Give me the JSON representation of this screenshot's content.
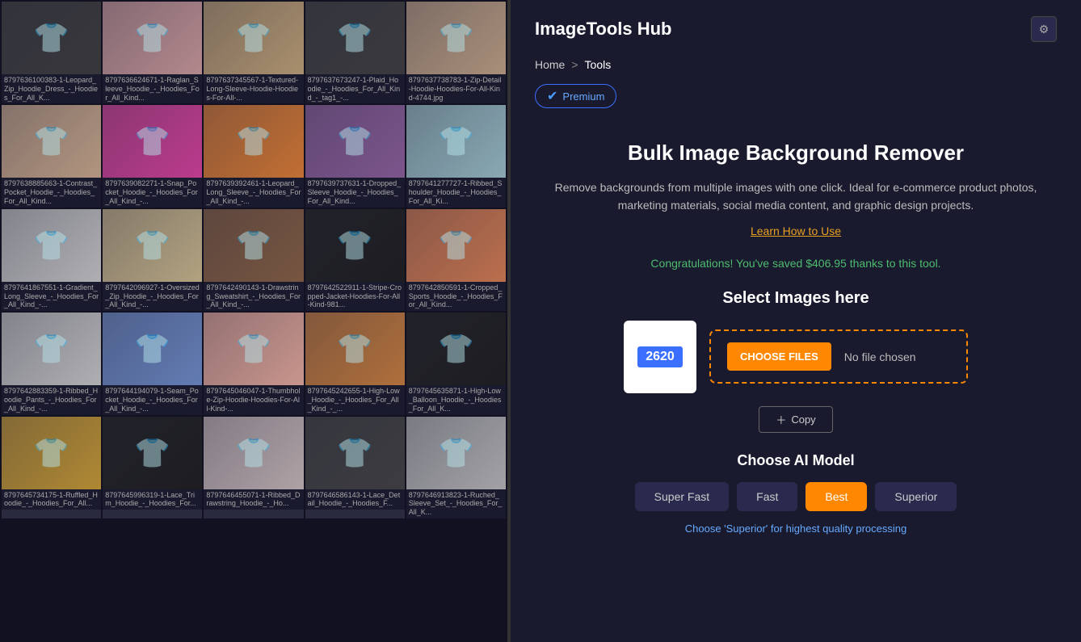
{
  "app": {
    "title": "ImageTools Hub"
  },
  "breadcrumb": {
    "home": "Home",
    "separator": ">",
    "current": "Tools"
  },
  "premium": {
    "label": "Premium"
  },
  "tool": {
    "title": "Bulk Image Background Remover",
    "description": "Remove backgrounds from multiple images with one click. Ideal for e-commerce product photos, marketing materials, social media content, and graphic design projects.",
    "learn_link": "Learn How to Use",
    "savings_msg": "Congratulations! You've saved $406.95 thanks to this tool.",
    "select_title": "Select Images here",
    "count": "2620",
    "choose_files_label": "CHOOSE FILES",
    "no_file_label": "No file chosen",
    "copy_label": "Copy",
    "model_title": "Choose AI Model",
    "model_hint": "Choose 'Superior' for highest quality processing"
  },
  "models": [
    {
      "id": "super-fast",
      "label": "Super Fast",
      "active": false
    },
    {
      "id": "fast",
      "label": "Fast",
      "active": false
    },
    {
      "id": "best",
      "label": "Best",
      "active": true
    },
    {
      "id": "superior",
      "label": "Superior",
      "active": false
    }
  ],
  "images": [
    {
      "id": "img-1",
      "label": "8797636100383-1-Leopard_Zip_Hoodie_Dress_-_Hoodies_For_All_K..."
    },
    {
      "id": "img-2",
      "label": "8797636624671-1-Raglan_Sleeve_Hoodie_-_Hoodies_For_All_Kind..."
    },
    {
      "id": "img-3",
      "label": "8797637345567-1-Textured-Long-Sleeve-Hoodie-Hoodies-For-All-..."
    },
    {
      "id": "img-4",
      "label": "8797637673247-1-Plaid_Hoodie_-_Hoodies_For_All_Kind_-_tag1_-..."
    },
    {
      "id": "img-5",
      "label": "8797637738783-1-Zip-Detail-Hoodie-Hoodies-For-All-Kind-4744.jpg"
    },
    {
      "id": "img-6",
      "label": "8797638885663-1-Contrast_Pocket_Hoodie_-_Hoodies_For_All_Kind..."
    },
    {
      "id": "img-7",
      "label": "8797639082271-1-Snap_Pocket_Hoodie_-_Hoodies_For_All_Kind_-..."
    },
    {
      "id": "img-8",
      "label": "8797639392461-1-Leopard_Long_Sleeve_-_Hoodies_For_All_Kind_-..."
    },
    {
      "id": "img-9",
      "label": "8797639737631-1-Dropped_Sleeve_Hoodie_-_Hoodies_For_All_Kind..."
    },
    {
      "id": "img-10",
      "label": "8797641277727-1-Ribbed_Shoulder_Hoodie_-_Hoodies_For_All_Ki..."
    },
    {
      "id": "img-11",
      "label": "8797641867551-1-Gradient_Long_Sleeve_-_Hoodies_For_All_Kind_-..."
    },
    {
      "id": "img-12",
      "label": "8797642096927-1-Oversized_Zip_Hoodie_-_Hoodies_For_All_Kind_-..."
    },
    {
      "id": "img-13",
      "label": "8797642490143-1-Drawstring_Sweatshirt_-_Hoodies_For_All_Kind_-..."
    },
    {
      "id": "img-14",
      "label": "8797642522911-1-Stripe-Cropped-Jacket-Hoodies-For-All-Kind-981..."
    },
    {
      "id": "img-15",
      "label": "8797642850591-1-Cropped_Sports_Hoodie_-_Hoodies_For_All_Kind..."
    },
    {
      "id": "img-16",
      "label": "8797642883359-1-Ribbed_Hoodie_Pants_-_Hoodies_For_All_Kind_-..."
    },
    {
      "id": "img-17",
      "label": "8797644194079-1-Seam_Pocket_Hoodie_-_Hoodies_For_All_Kind_-..."
    },
    {
      "id": "img-18",
      "label": "8797645046047-1-Thumbhole-Zip-Hoodie-Hoodies-For-All-Kind-..."
    },
    {
      "id": "img-19",
      "label": "8797645242655-1-High-Low_Hoodie_-_Hoodies_For_All_Kind_-_..."
    },
    {
      "id": "img-20",
      "label": "8797645635871-1-High-Low_Balloon_Hoodie_-_Hoodies_For_All_K..."
    },
    {
      "id": "img-21",
      "label": "8797645734175-1-Ruffled_Hoodie_-_Hoodies_For_All..."
    },
    {
      "id": "img-22",
      "label": "8797645996319-1-Lace_Trim_Hoodie_-_Hoodies_For..."
    },
    {
      "id": "img-23",
      "label": "8797646455071-1-Ribbed_Drawstring_Hoodie_-_Ho..."
    },
    {
      "id": "img-24",
      "label": "8797646586143-1-Lace_Detail_Hoodie_-_Hoodies_F..."
    },
    {
      "id": "img-25",
      "label": "8797646913823-1-Ruched_Sleeve_Set_-_Hoodies_For_All_K..."
    }
  ],
  "image_colors": [
    "#3a3a3a",
    "#d4a0a0",
    "#c8a878",
    "#3d3d3d",
    "#c8a888",
    "#d4b090",
    "#e040a0",
    "#e88030",
    "#9060a0",
    "#a0c8d0",
    "#d0d0d0",
    "#d4c090",
    "#8a6040",
    "#1a1a1a",
    "#e08050",
    "#d0d0d0",
    "#7090d0",
    "#f0b0a0",
    "#d0803a",
    "#1a1a1a",
    "#d0a030",
    "#1a1a1a",
    "#d0c0c0",
    "#404040",
    "#c0c0c0"
  ]
}
